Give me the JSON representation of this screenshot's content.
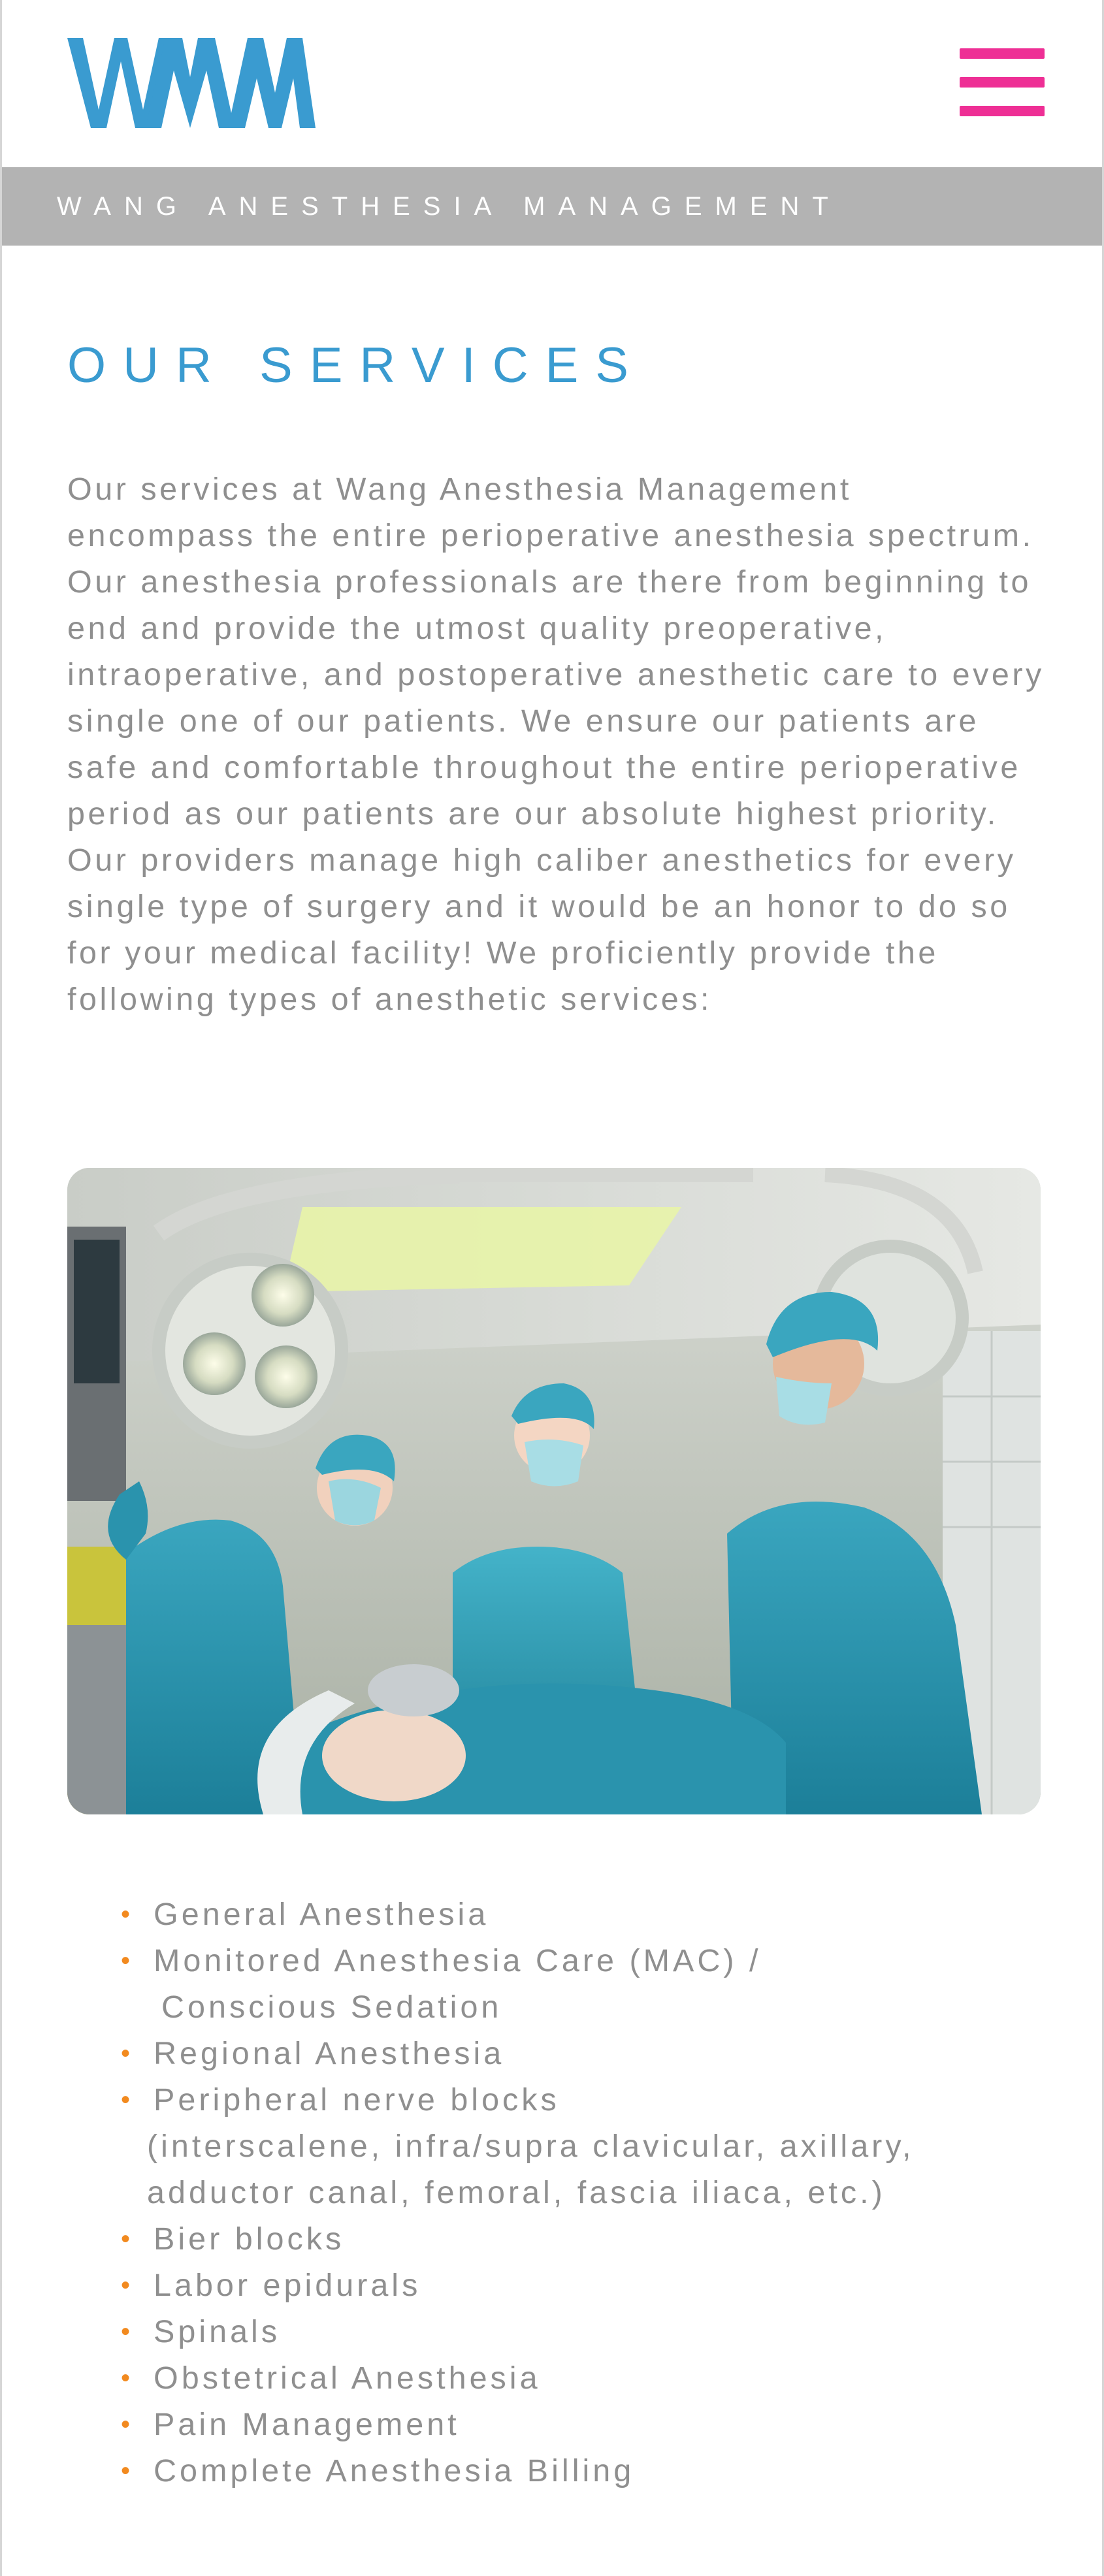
{
  "header": {
    "logo_text": "WAM",
    "logo_icon": "wam-logo",
    "menu_icon": "hamburger-menu-icon",
    "brand_color": "#3a9bd0",
    "menu_color": "#ee2f95"
  },
  "banner": {
    "text": "WANG ANESTHESIA MANAGEMENT",
    "bg_color": "#b3b3b3"
  },
  "main": {
    "title": "OUR SERVICES",
    "intro": "Our services at Wang Anesthesia Management encompass the entire perioperative anesthesia spectrum. Our anesthesia professionals are there from beginning to end and provide the utmost quality preoperative, intraoperative, and postoperative anesthetic care to every single one of our patients. We ensure our patients are safe and comfortable throughout the entire perioperative period as our patients are our absolute highest priority. Our providers manage high caliber anesthetics for every single type of surgery and it would be an honor to do so for your medical facility! We proficiently provide the following types of anesthetic services:",
    "photo_icon": "operating-room-photo",
    "bullet_color": "#f28a1f",
    "services": [
      {
        "label": "General Anesthesia"
      },
      {
        "label": "Monitored Anesthesia Care (MAC) /",
        "sub": "Conscious Sedation"
      },
      {
        "label": "Regional Anesthesia"
      },
      {
        "label": "Peripheral nerve blocks",
        "sub": "(interscalene, infra/supra clavicular, axillary,",
        "sub2": "adductor canal, femoral, fascia iliaca, etc.)"
      },
      {
        "label": "Bier blocks"
      },
      {
        "label": "Labor epidurals"
      },
      {
        "label": "Spinals"
      },
      {
        "label": "Obstetrical Anesthesia"
      },
      {
        "label": "Pain Management"
      },
      {
        "label": "Complete Anesthesia Billing"
      }
    ]
  }
}
